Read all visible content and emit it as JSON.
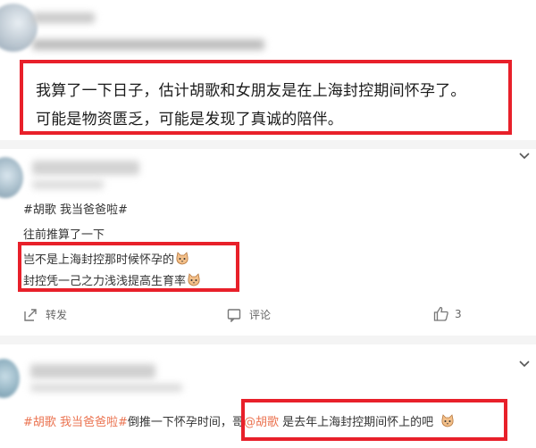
{
  "comment1": {
    "meta_blurred": "来自 苹果手机",
    "line1": "我算了一下日子，估计胡歌和女朋友是在上海封控期间怀孕了。",
    "line2": "可能是物资匮乏，可能是发现了真诚的陪伴。"
  },
  "comment2": {
    "topic": "#胡歌 我当爸爸啦#",
    "line1": "往前推算了一下",
    "line2": "岂不是上海封控那时候怀孕的",
    "line3": "封控凭一己之力浅浅提高生育率",
    "actions": {
      "repost": "转发",
      "comment": "评论",
      "likes": "3"
    }
  },
  "comment3": {
    "topic": "#胡歌 我当爸爸啦#",
    "text_pre": "倒推一下怀孕时间，",
    "text_ge": "哥",
    "mention": "@胡歌",
    "text_post": " 是去年上海封控期间怀上的吧"
  },
  "colors": {
    "highlight_box": "#e8202a",
    "topic_link": "#eb7350",
    "divider": "#f4f4f4"
  },
  "icons": [
    "chevron-down-icon",
    "repost-icon",
    "comment-icon",
    "like-icon",
    "cat-emoji-icon"
  ]
}
